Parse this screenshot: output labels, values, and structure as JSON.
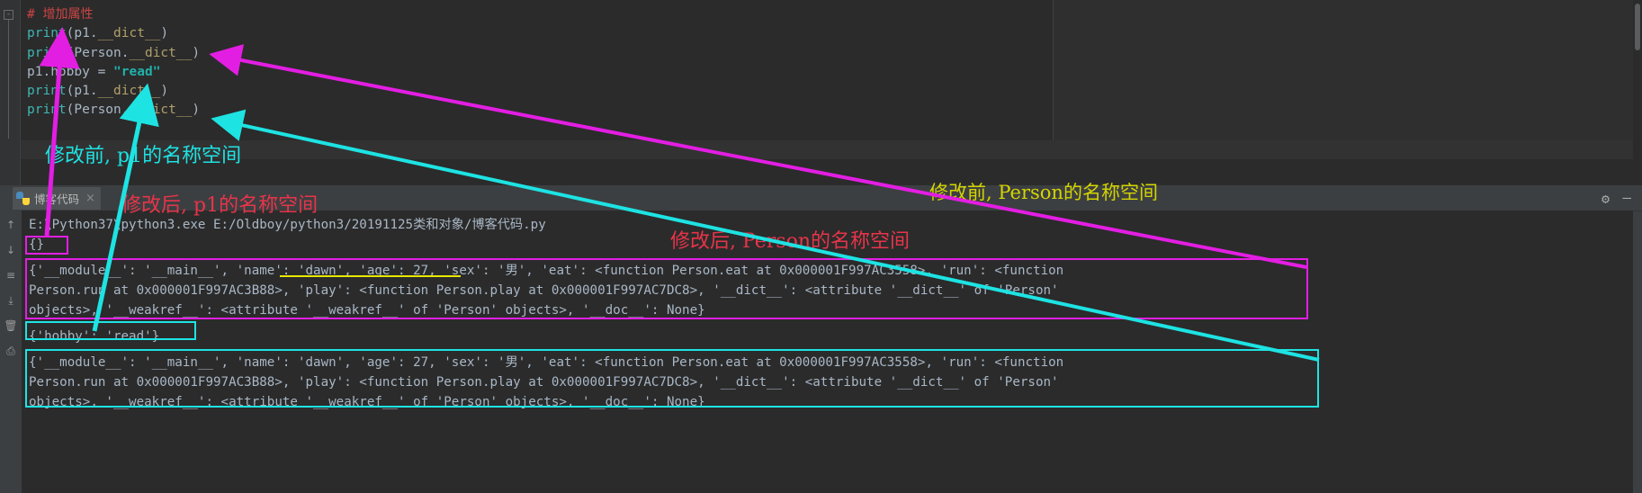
{
  "editor": {
    "fold_marker": "-",
    "lines": [
      {
        "id": "line-comment",
        "parts": [
          {
            "t": "# ",
            "c": "c-comment"
          },
          {
            "t": "增加属性",
            "c": "c-comment-cn"
          }
        ]
      },
      {
        "id": "line-print-p1-dict-1",
        "parts": [
          {
            "t": "print",
            "c": "c-fn"
          },
          {
            "t": "(p1.",
            "c": "c-plain"
          },
          {
            "t": "__dict__",
            "c": "c-dunder"
          },
          {
            "t": ")",
            "c": "c-plain"
          }
        ]
      },
      {
        "id": "line-print-person-dict-1",
        "parts": [
          {
            "t": "print",
            "c": "c-fn"
          },
          {
            "t": "(Person.",
            "c": "c-plain"
          },
          {
            "t": "__dict__",
            "c": "c-dunder"
          },
          {
            "t": ")",
            "c": "c-plain"
          }
        ]
      },
      {
        "id": "line-assign-hobby",
        "parts": [
          {
            "t": "p1.hobby ",
            "c": "c-plain"
          },
          {
            "t": "= ",
            "c": "c-op"
          },
          {
            "t": "\"read\"",
            "c": "c-str"
          }
        ]
      },
      {
        "id": "line-print-p1-dict-2",
        "parts": [
          {
            "t": "print",
            "c": "c-fn"
          },
          {
            "t": "(p1.",
            "c": "c-plain"
          },
          {
            "t": "__dict__",
            "c": "c-dunder"
          },
          {
            "t": ")",
            "c": "c-plain"
          }
        ]
      },
      {
        "id": "line-print-person-dict-2",
        "parts": [
          {
            "t": "print",
            "c": "c-fn"
          },
          {
            "t": "(Person.",
            "c": "c-plain"
          },
          {
            "t": "__dict__",
            "c": "c-dunder"
          },
          {
            "t": ")",
            "c": "c-plain"
          }
        ]
      }
    ]
  },
  "toolwindow": {
    "tab_label": "博客代码",
    "tab_close": "×",
    "gear_icon": "⚙",
    "minimize_icon": "—",
    "left_icons": [
      "↑",
      "↓",
      "≡",
      "⤓",
      "🗑",
      "⎙"
    ]
  },
  "console": {
    "command_line": "E:\\Python37\\python3.exe E:/Oldboy/python3/20191125类和对象/博客代码.py",
    "line_empty_dict": "{}",
    "person_dict_1": [
      "{'__module__': '__main__', 'name': 'dawn', 'age': 27, 'sex': '男', 'eat': <function Person.eat at 0x000001F997AC3558>, 'run': <function",
      "Person.run at 0x000001F997AC3B88>, 'play': <function Person.play at 0x000001F997AC7DC8>, '__dict__': <attribute '__dict__' of 'Person'",
      "objects>, '__weakref__': <attribute '__weakref__' of 'Person' objects>, '__doc__': None}"
    ],
    "line_hobby_dict": "{'hobby': 'read'}",
    "person_dict_2": [
      "{'__module__': '__main__', 'name': 'dawn', 'age': 27, 'sex': '男', 'eat': <function Person.eat at 0x000001F997AC3558>, 'run': <function",
      "Person.run at 0x000001F997AC3B88>, 'play': <function Person.play at 0x000001F997AC7DC8>, '__dict__': <attribute '__dict__' of 'Person'",
      "objects>, '__weakref__': <attribute '__weakref__' of 'Person' objects>, '__doc__': None}"
    ]
  },
  "annotations": {
    "before_p1": "修改前, p1的名称空间",
    "after_p1": "修改后, p1的名称空间",
    "before_person": "修改前, Person的名称空间",
    "after_person": "修改后, Person的名称空间"
  },
  "colors": {
    "magenta": "#e31ee3",
    "cyan": "#1ee3e3",
    "red": "#e8344a",
    "yellow": "#d4d400",
    "editor_bg": "#2b2b2b",
    "panel_bg": "#3c3f41"
  }
}
